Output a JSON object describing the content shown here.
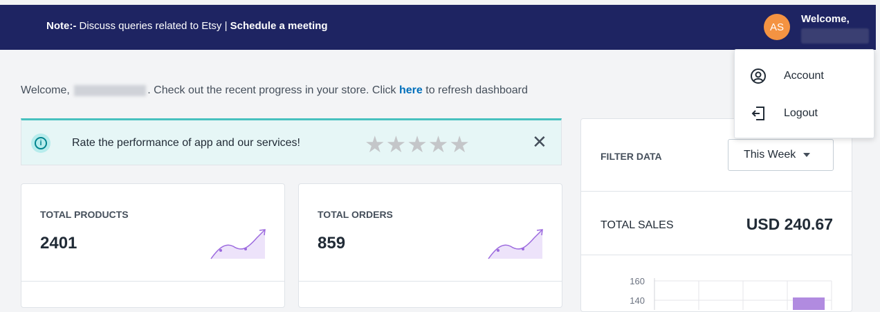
{
  "topbar": {
    "note_prefix": "Note:-",
    "note_text": " Discuss queries related to Etsy | ",
    "schedule_link": "Schedule a meeting",
    "avatar_initials": "AS",
    "welcome": "Welcome,"
  },
  "account_menu": {
    "items": [
      {
        "label": "Account",
        "icon": "account-icon"
      },
      {
        "label": "Logout",
        "icon": "logout-icon"
      }
    ]
  },
  "welcome_line": {
    "prefix": "Welcome, ",
    "name_suffix": "",
    "middle": ". Check out the recent progress in your store. Click ",
    "link": "here",
    "suffix": " to refresh dashboard"
  },
  "rating_banner": {
    "text": "Rate the performance of app and our services!",
    "stars": 5,
    "close_label": "✕"
  },
  "cards": [
    {
      "title": "TOTAL PRODUCTS",
      "value": "2401",
      "icon": "trend-up-icon"
    },
    {
      "title": "TOTAL ORDERS",
      "value": "859",
      "icon": "trend-up-icon"
    }
  ],
  "filter": {
    "label": "FILTER DATA",
    "selected": "This Week",
    "sales_label": "TOTAL SALES",
    "sales_value": "USD 240.67",
    "chart_ticks": [
      "160",
      "140"
    ]
  },
  "colors": {
    "topbar": "#1e2462",
    "avatar": "#f49342",
    "banner_accent": "#47c1bf",
    "link": "#006fbb",
    "trend_line": "#9c6ade",
    "bar": "#b18be0"
  }
}
